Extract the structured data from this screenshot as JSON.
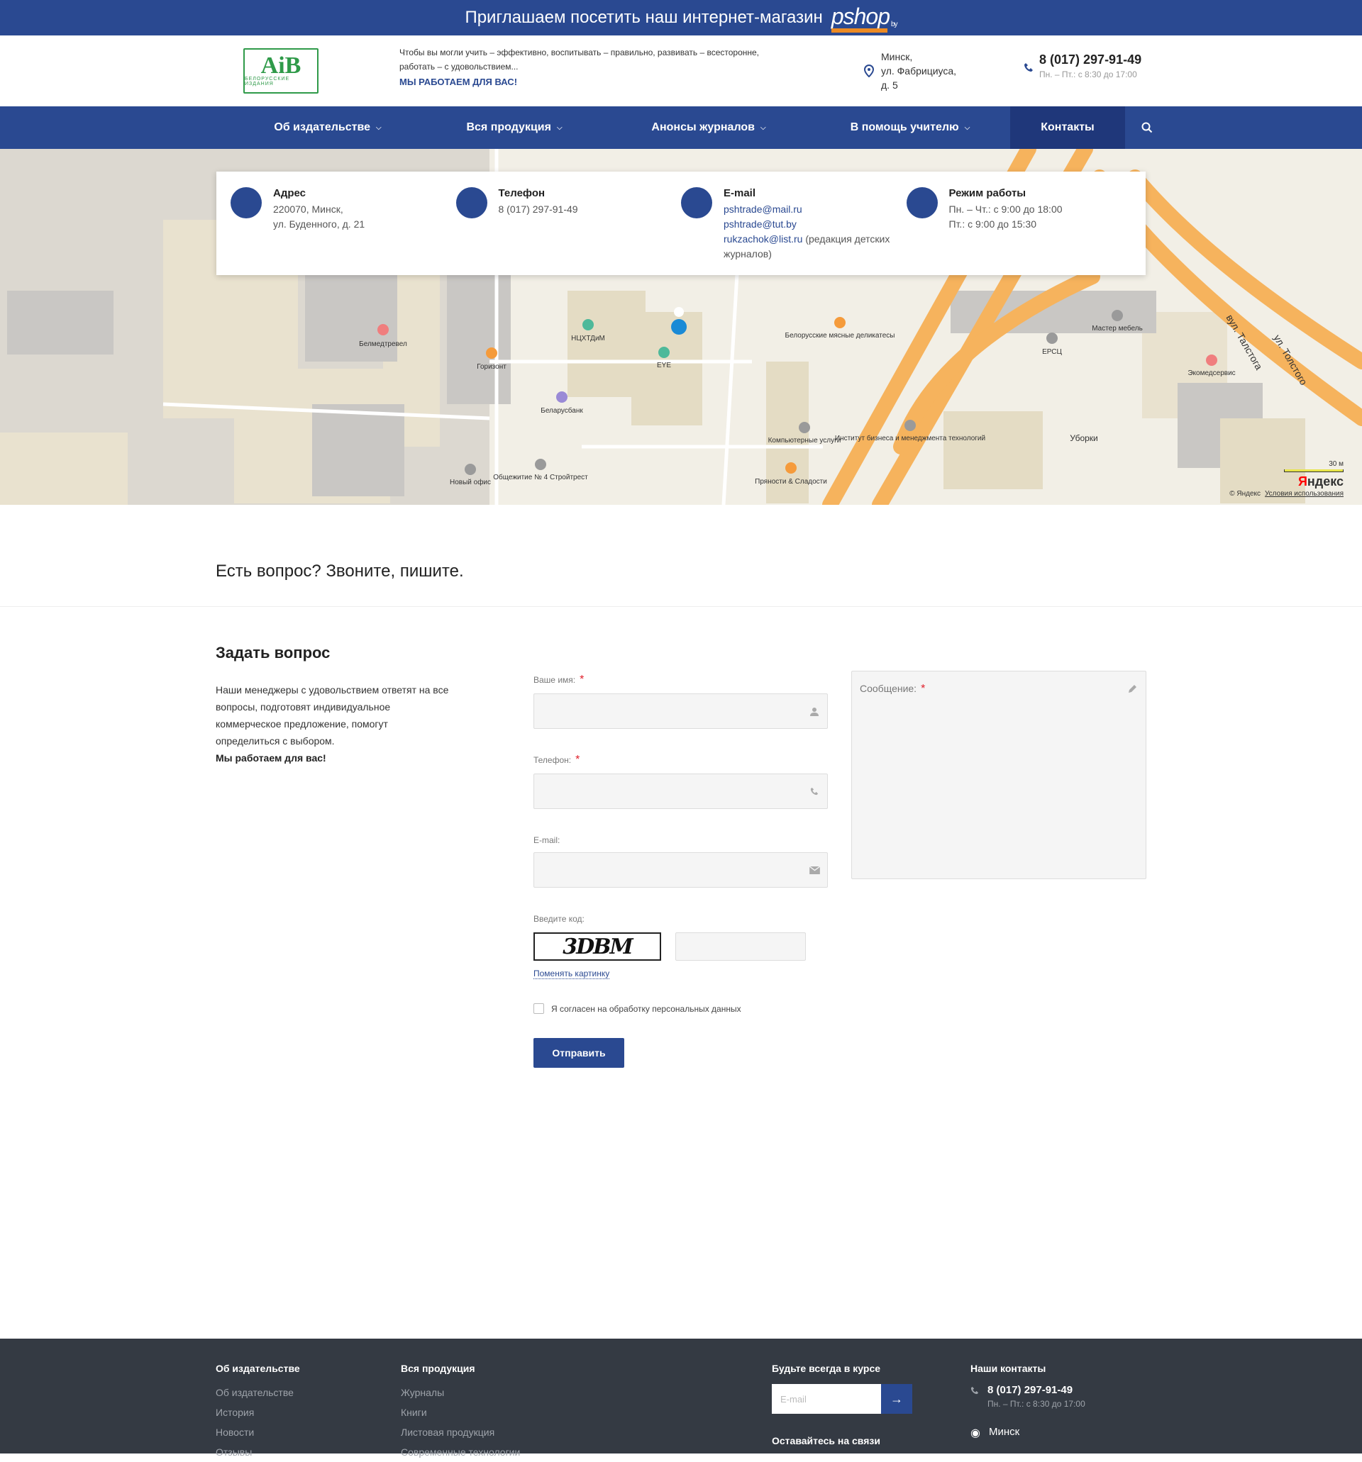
{
  "promo": {
    "text": "Приглашаем посетить наш интернет-магазин",
    "shop_logo": "pshop",
    "shop_tld": "by"
  },
  "header": {
    "logo_text": "АiВ",
    "logo_sub": "БЕЛОРУССКИЕ ИЗДАНИЯ",
    "slogan": "Чтобы вы могли учить – эффективно, воспитывать – правильно, развивать – всесторонне, работать – с удовольствием...",
    "slogan_strong": "МЫ РАБОТАЕМ ДЛЯ ВАС!",
    "address_lines": [
      "Минск,",
      "ул. Фабрициуса,",
      "д. 5"
    ],
    "phone": "8 (017) 297-91-49",
    "hours": "Пн. – Пт.: с 8:30 до 17:00"
  },
  "nav": {
    "items": [
      {
        "label": "Об издательстве"
      },
      {
        "label": "Вся продукция"
      },
      {
        "label": "Анонсы журналов"
      },
      {
        "label": "В помощь учителю"
      },
      {
        "label": "Контакты"
      }
    ]
  },
  "contacts": {
    "address": {
      "title": "Адрес",
      "lines": [
        "220070, Минск,",
        "ул. Буденного, д. 21"
      ]
    },
    "phone": {
      "title": "Телефон",
      "value": "8 (017) 297-91-49"
    },
    "email": {
      "title": "E-mail",
      "links": [
        "pshtrade@mail.ru",
        "pshtrade@tut.by",
        "rukzachok@list.ru"
      ],
      "note": "(редакция детских журналов)"
    },
    "hours": {
      "title": "Режим работы",
      "lines": [
        "Пн. – Чт.: с 9:00 до 18:00",
        "Пт.: с 9:00 до 15:30"
      ]
    }
  },
  "map": {
    "labels": [
      "Белмедтревел",
      "Горизонт",
      "НЦХТДиМ",
      "EYE",
      "Беларусбанк",
      "Новый офис",
      "Общежитие № 4 Стройтрест",
      "Белорусские мясные деликатесы",
      "Компьютерные услуги",
      "Пряности & Сладости",
      "Институт бизнеса и менеджмента технологий",
      "ЕРСЦ",
      "Мастер мебель",
      "Экомедсервис",
      "Уборки",
      "вул. Талстога",
      "ул. Толстого"
    ],
    "scale": "30 м",
    "brand": "Яндекс",
    "attribution": "© Яндекс",
    "terms": "Условия использования"
  },
  "question": {
    "title": "Есть вопрос? Звоните, пишите."
  },
  "form": {
    "title": "Задать вопрос",
    "intro": "Наши менеджеры с удовольствием ответят на все вопросы, подготовят индивидуальное коммерческое предложение, помогут определиться с выбором.",
    "intro_strong": "Мы работаем для вас!",
    "name_label": "Ваше имя:",
    "phone_label": "Телефон:",
    "email_label": "E-mail:",
    "message_label": "Сообщение:",
    "captcha_label": "Введите код:",
    "captcha_text": "3DBM",
    "captcha_link": "Поменять картинку",
    "agree_label": "Я согласен на обработку персональных данных",
    "required_mark": "*",
    "submit": "Отправить"
  },
  "footer": {
    "col1": {
      "title": "Об издательстве",
      "items": [
        "Об издательстве",
        "История",
        "Новости",
        "Отзывы"
      ]
    },
    "col2": {
      "title": "Вся продукция",
      "items": [
        "Журналы",
        "Книги",
        "Листовая продукция",
        "Современные технологии"
      ]
    },
    "subscribe": {
      "title": "Будьте всегда в курсе",
      "placeholder": "E-mail",
      "title2": "Оставайтесь на связи"
    },
    "contacts": {
      "title": "Наши контакты",
      "phone": "8 (017) 297-91-49",
      "hours": "Пн. – Пт.: с 8:30 до 17:00",
      "city": "Минск"
    }
  },
  "colors": {
    "primary": "#2a4991",
    "primary_dark": "#1f377a",
    "footer_bg": "#343a43",
    "required": "#e0202b",
    "road": "#f6b35d"
  }
}
